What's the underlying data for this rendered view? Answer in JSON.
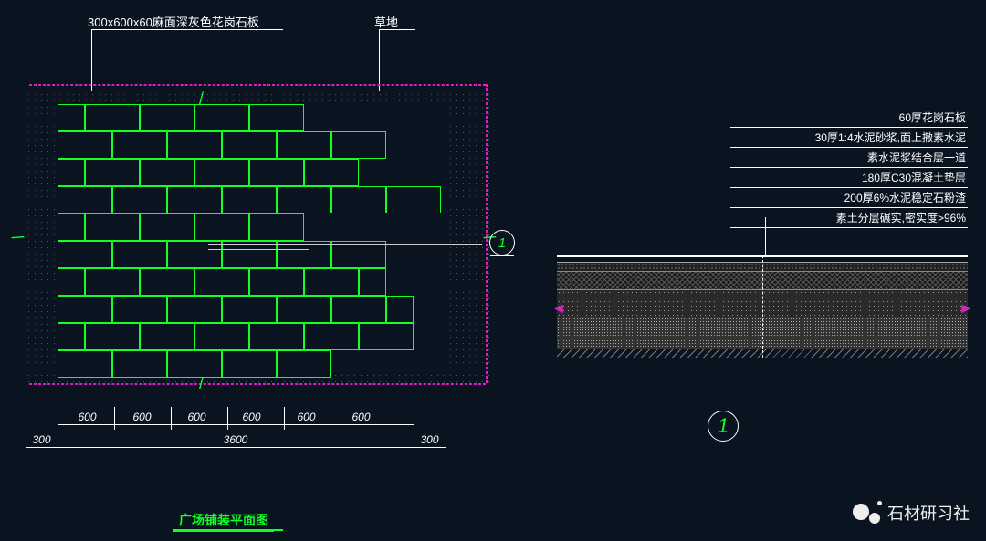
{
  "callouts": {
    "granite": "300x600x60麻面深灰色花岗石板",
    "grass": "草地"
  },
  "plan": {
    "title": "广场铺装平面图",
    "dims_top_row": [
      "600",
      "600",
      "600",
      "600",
      "600",
      "600"
    ],
    "dim_side_left": "300",
    "dim_side_right": "300",
    "dim_total": "3600",
    "section_mark": "1"
  },
  "section": {
    "legend": [
      "60厚花岗石板",
      "30厚1:4水泥砂浆,面上撒素水泥",
      "素水泥浆结合层一道",
      "180厚C30混凝土垫层",
      "200厚6%水泥稳定石粉渣",
      "素土分层碾实,密实度>96%"
    ],
    "mark": "1"
  },
  "watermark": "石材研习社"
}
